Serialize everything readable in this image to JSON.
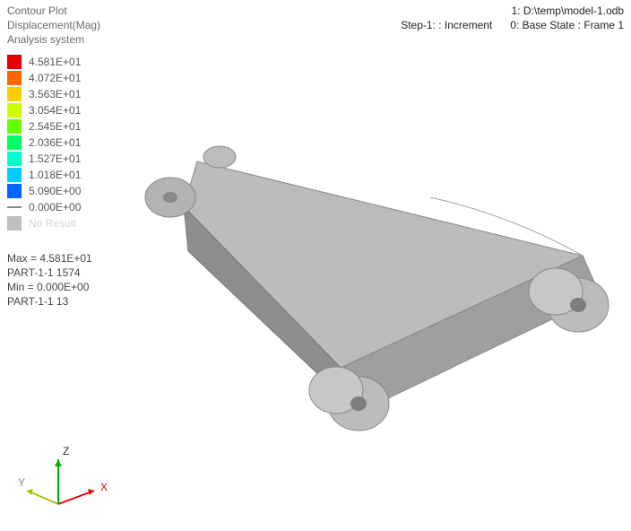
{
  "header": {
    "plot_type": "Contour Plot",
    "result_name": "Displacement(Mag)",
    "system": "Analysis system",
    "file_label": "1: D:\\temp\\model-1.odb",
    "step_label": "Step-1: : Increment",
    "frame_label": "0: Base State : Frame 1"
  },
  "legend": {
    "items": [
      {
        "value": "4.581E+01",
        "color": "#e60000"
      },
      {
        "value": "4.072E+01",
        "color": "#ff6600"
      },
      {
        "value": "3.563E+01",
        "color": "#ffcc00"
      },
      {
        "value": "3.054E+01",
        "color": "#ccff00"
      },
      {
        "value": "2.545E+01",
        "color": "#66ff00"
      },
      {
        "value": "2.036E+01",
        "color": "#00ff66"
      },
      {
        "value": "1.527E+01",
        "color": "#00ffcc"
      },
      {
        "value": "1.018E+01",
        "color": "#00ccff"
      },
      {
        "value": "5.090E+00",
        "color": "#0066ff"
      }
    ],
    "last_value": "0.000E+00",
    "no_result": "No Result"
  },
  "stats": {
    "max_label": "Max =  4.581E+01",
    "max_loc": "PART-1-1 1574",
    "min_label": "Min =  0.000E+00",
    "min_loc": "PART-1-1 13"
  },
  "triad": {
    "x": "X",
    "y": "Y",
    "z": "Z"
  }
}
